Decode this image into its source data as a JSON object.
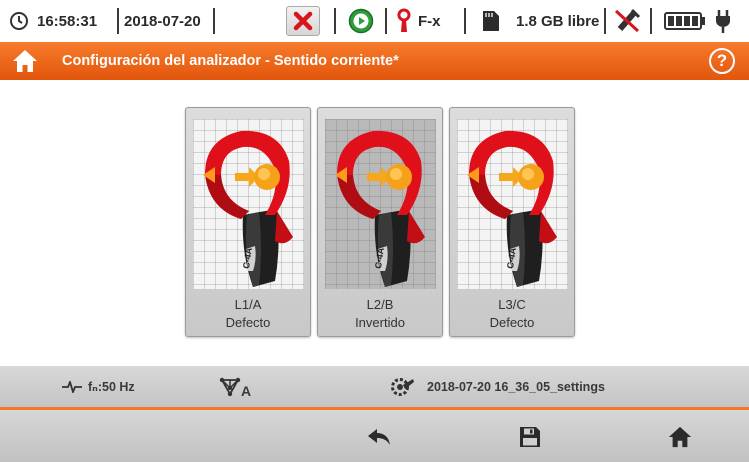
{
  "status": {
    "time": "16:58:31",
    "date": "2018-07-20",
    "trigger_label": "F-x",
    "storage": "1.8 GB libre"
  },
  "title": {
    "text": "Configuración del analizador - Sentido corriente*",
    "help": "?"
  },
  "clamps": [
    {
      "phase": "L1/A",
      "state": "Defecto",
      "clamp_text": "C-4A"
    },
    {
      "phase": "L2/B",
      "state": "Invertido",
      "clamp_text": "C-4A"
    },
    {
      "phase": "L3/C",
      "state": "Defecto",
      "clamp_text": "C-4A"
    }
  ],
  "info": {
    "frequency": "fₙ:50 Hz",
    "connection_label": "A",
    "settings_file": "2018-07-20 16_36_05_settings"
  },
  "colors": {
    "accent": "#ee6a1e",
    "clamp_red": "#e0101a",
    "clamp_black": "#1e1e1e",
    "jaw_orange": "#f5a11a"
  }
}
